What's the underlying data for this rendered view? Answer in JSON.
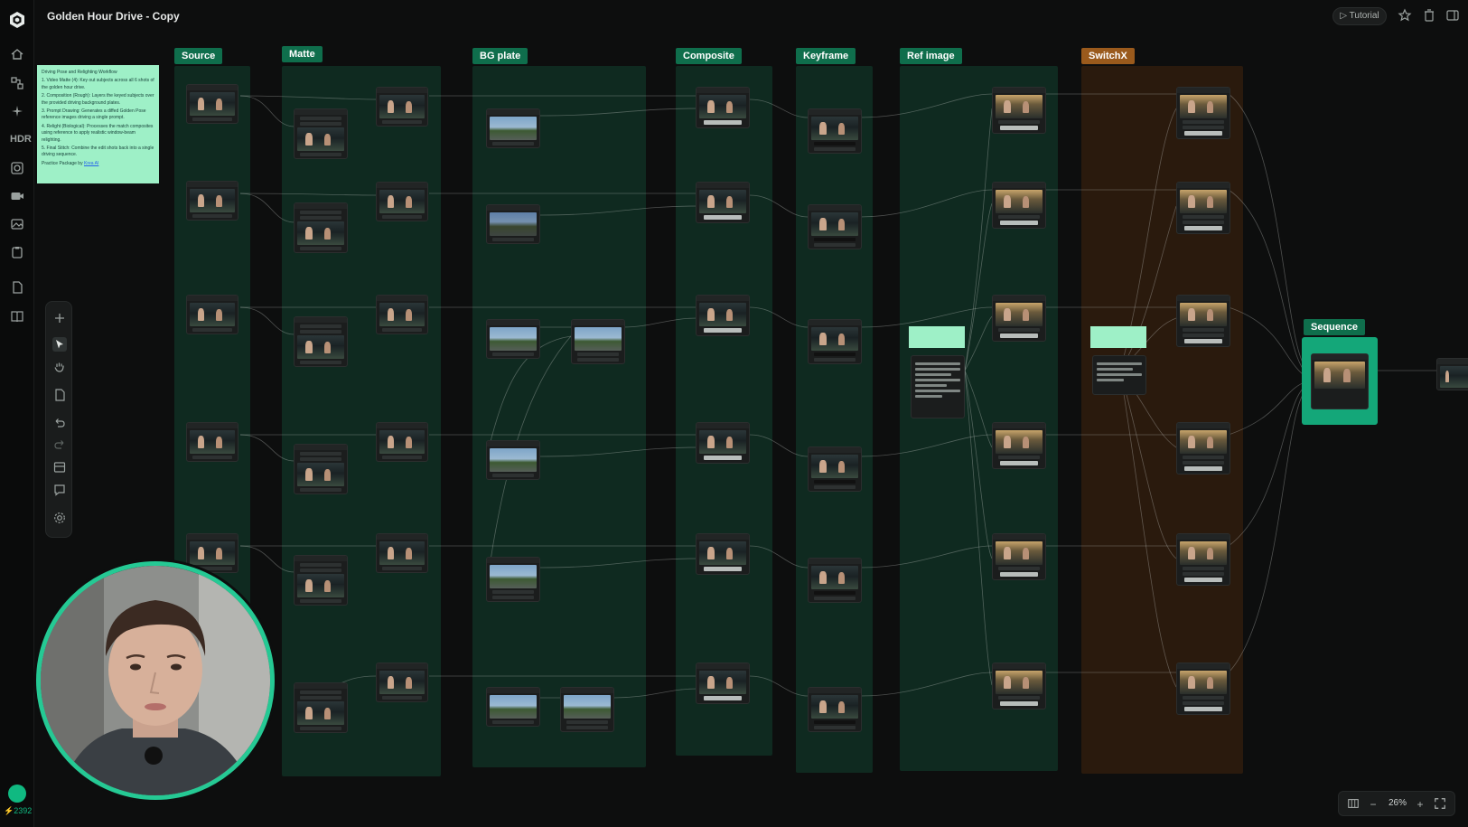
{
  "app": {
    "title": "Golden Hour Drive - Copy",
    "credits": "2392"
  },
  "topbar": {
    "tutorial_label": "Tutorial"
  },
  "rail": {
    "hdr_label": "HDR"
  },
  "groups": {
    "source": "Source",
    "matte": "Matte",
    "bg_plate": "BG plate",
    "composite": "Composite",
    "keyframe": "Keyframe",
    "ref_image": "Ref image",
    "switchx": "SwitchX",
    "sequence": "Sequence"
  },
  "note": {
    "title": "Driving Pose and Relighting Workflow",
    "lines": [
      "1. Video Matte (4): Key out subjects across all 6 shots of the golden hour drive.",
      "2. Composition (Rough): Layers the keyed subjects over the provided driving background plates.",
      "3. Prompt Drawing: Generates a diffed Golden Pose reference images driving a single prompt.",
      "4. Relight (Biological): Processes the match composites using reference to apply realistic window-beam relighting.",
      "5. Final Stitch: Combine the edit shots back into a single driving sequence."
    ],
    "footer": "Practice Package by",
    "footer_link": "Krea AI"
  },
  "zoom": {
    "value": "26%"
  },
  "colors": {
    "accent": "#10b981",
    "group_green": "#0f2a20",
    "group_orange": "#2a1a0d",
    "label_green": "#0f6e4c",
    "label_orange": "#9a5a1c",
    "note_bg": "#9ef0c7"
  }
}
